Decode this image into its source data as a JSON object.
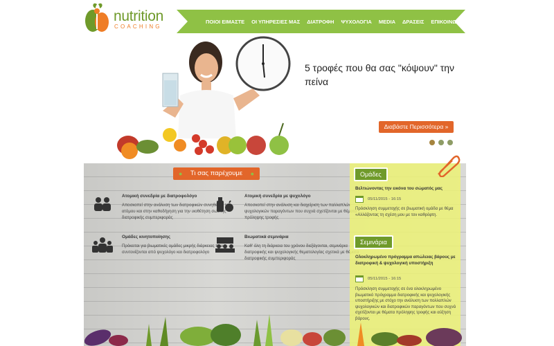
{
  "logo": {
    "line1": "nutrition",
    "line2": "COACHING"
  },
  "nav": {
    "items": [
      "ΠΟΙΟΙ ΕΙΜΑΣΤΕ",
      "ΟΙ ΥΠΗΡΕΣΙΕΣ ΜΑΣ",
      "ΔΙΑΤΡΟΦΗ",
      "ΨΥΧΟΛΟΓΙΑ",
      "MEDIA",
      "ΔΡΑΣΕΙΣ",
      "ΕΠΙΚΟΙΝΩΝΙΑ"
    ]
  },
  "hero": {
    "title": "5 τροφές που θα σας \"κόψουν\" την πείνα",
    "read_more": "Διαβάστε Περισσότερα »",
    "slides": 3,
    "active_slide": 1
  },
  "services": {
    "heading": "Τι σας παρέχουμε",
    "items": [
      {
        "icon": "two-people-icon",
        "title": "Ατομική συνεδρία με διατροφολόγο",
        "text": "Αποσκοπεί στην ανάλυση των διατροφικών συνηθειών του ατόμου και στην καθοδήγηση για την υιοθέτηση σωστής διατροφικής συμπεριφοράς"
      },
      {
        "icon": "bottle-apple-icon",
        "title": "Ατομική συνεδρία με ψυχολόγο",
        "text": "Αποσκοπεί στην ανάλυση και διαχείριση των παλλαπλών ψυχολογικών παραγόντων που συχνά σχετίζονται με θέματα πρόληψης τροφής"
      },
      {
        "icon": "group-icon",
        "title": "Ομάδες κινητοποίησης",
        "text": "Πρόκειται για βιωματικές ομάδες μικρής διάρκειας που συντονίζονται από ψυχολόγο και διατροφολόγο"
      },
      {
        "icon": "seminar-icon",
        "title": "Βιωματικά σεμινάρια",
        "text": "Καθ' όλη τη διάρκεια του χρόνου διεξάγονται, σεμινάρια διατροφικής και ψυχολογικής θεματολογίας σχετικά με θέματα διατροφικής συμπεριφοράς"
      }
    ]
  },
  "groups": {
    "heading": "Ομάδες",
    "title": "Βελτιώνοντας την εικόνα του σώματός μας",
    "date": "05/11/2015 - 16:15",
    "text": "Πρόσκληση συμμετοχής σε βιωματική ομάδα με θέμα «Αλλάζοντας τη σχέση μου με τον καθρέφτη."
  },
  "seminars": {
    "heading": "Σεμινάρια",
    "title": "Ολοκληρωμένο πρόγραμμα απώλειας βάρους με διατροφική & ψυχολογική υποστήριξη",
    "date": "05/11/2015 - 16:15",
    "text": "Πρόσκληση συμμετοχής σε ένα ολοκληρωμένο βιωματικό πρόγραμμα διατροφικής και ψυχολογικής υποστήριξης με στόχο την ανάλυση των πολλαπλών ψυχολογικών και διατροφικών παραγόντων που συχνά σχετίζονται με θέματα πρόληψης τροφής και αύξηση βάρους."
  },
  "colors": {
    "green": "#8fc145",
    "dark_green": "#6f9a2a",
    "orange": "#e2662a",
    "yellow_panel": "#ecf276"
  }
}
